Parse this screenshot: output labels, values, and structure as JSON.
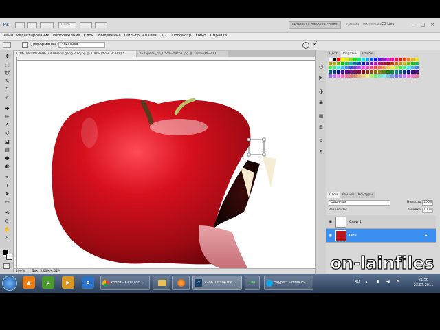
{
  "app": {
    "logo": "Ps",
    "zoom": "100%",
    "workspace_button": "Основная рабочая среда",
    "design_link": "Дизайн",
    "painting_link": "Рисование",
    "more": "»",
    "cs_live": "CS Live",
    "window_controls": [
      "–",
      "□",
      "×"
    ]
  },
  "menu": [
    "Файл",
    "Редактирование",
    "Изображение",
    "Слои",
    "Выделение",
    "Фильтр",
    "Анализ",
    "3D",
    "Просмотр",
    "Окно",
    "Справка"
  ],
  "options": {
    "mode_label": "Деформация:",
    "mode_value": "Заказная"
  },
  "tabs": [
    {
      "label": "1286106104186961442Ihlang gang 202.jpg @ 100% (Фон, RGB/8) *",
      "close": "×"
    },
    {
      "label": "акварель_по_Пасть-тигра.jpg @ 100% (RGB/8)",
      "close": "×"
    }
  ],
  "status": {
    "zoom": "100%",
    "doc": "Док: 3,00M/4,02M"
  },
  "panels": {
    "top_tabs": [
      "Цвет",
      "Образцы",
      "Стили"
    ],
    "active_top_tab": "Образцы",
    "layers_tabs": [
      "Слои",
      "Каналы",
      "Контуры"
    ],
    "blend_mode": "Обычные",
    "opacity_label": "Непрозр.:",
    "opacity": "100%",
    "lock_label": "Закрепить:",
    "fill_label": "Заливка:",
    "fill": "100%",
    "layers": [
      {
        "name": "Слой 1",
        "selected": false
      },
      {
        "name": "Фон",
        "selected": true
      }
    ],
    "colors": {
      "selection": "#3b8ff0"
    }
  },
  "taskbar": {
    "apps": [
      {
        "icon": "vlc-icon",
        "label": "▲",
        "color": "#e87b12"
      },
      {
        "icon": "utorrent-icon",
        "label": "µ",
        "color": "#4a9a2a"
      },
      {
        "icon": "media-player-icon",
        "label": "▶",
        "color": "#d89722"
      },
      {
        "icon": "ie-icon",
        "label": "e",
        "color": "#2b73c8"
      }
    ],
    "windows": [
      {
        "label": "Уроки - Каталог ...",
        "icon": "chrome-icon"
      },
      {
        "label": "",
        "icon": "folder-icon"
      },
      {
        "label": "",
        "icon": "firefox-icon"
      },
      {
        "label": "1286106104186...",
        "icon": "photoshop-icon"
      },
      {
        "label": "Dw",
        "icon": "dreamweaver-icon"
      },
      {
        "label": "Skype™ - dima25...",
        "icon": "skype-icon"
      }
    ],
    "lang": "RU",
    "time": "21:56",
    "date": "23.07.2011"
  },
  "watermark": "on-lainfiles"
}
